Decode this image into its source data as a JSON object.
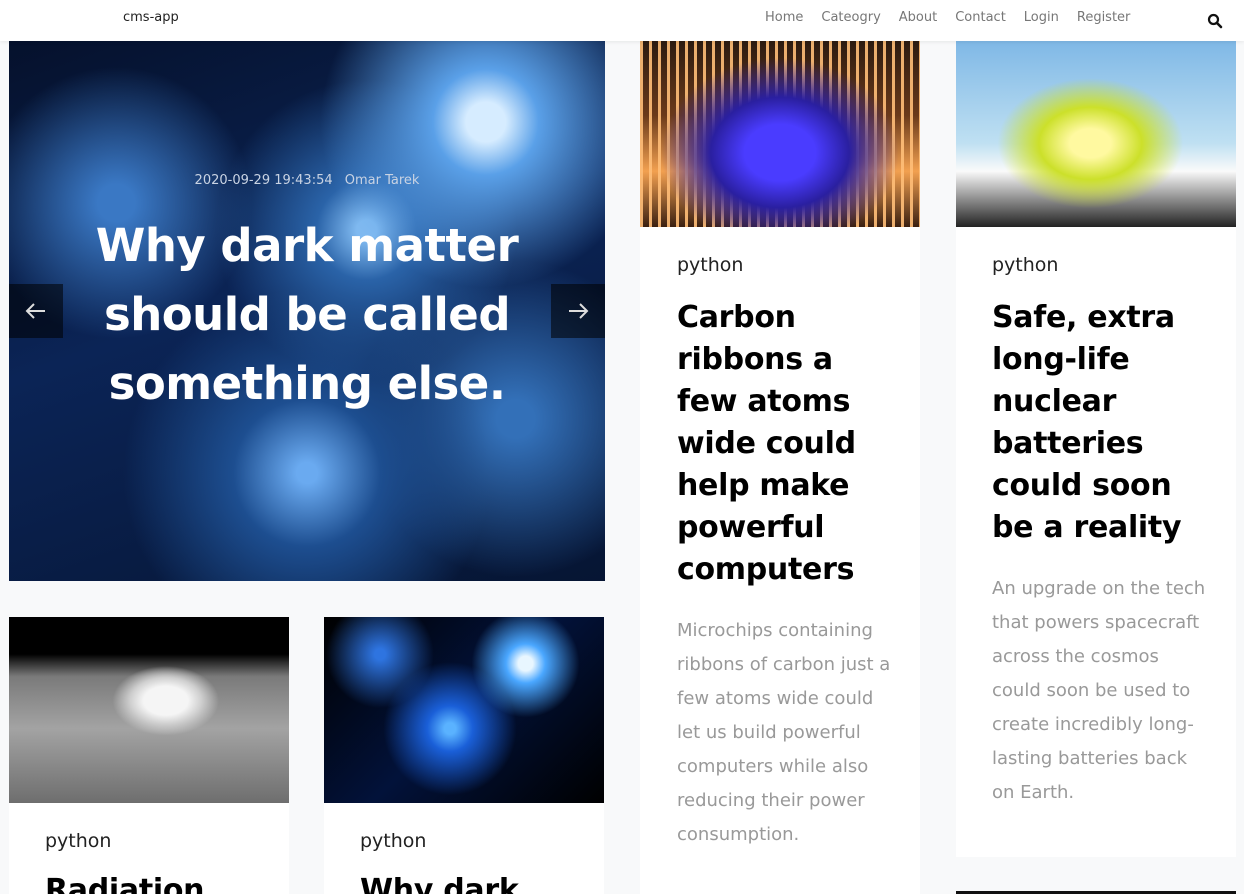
{
  "navbar": {
    "brand": "cms-app",
    "links": [
      "Home",
      "Cateogry",
      "About",
      "Contact",
      "Login",
      "Register"
    ],
    "search_icon": "search-icon"
  },
  "hero": {
    "date": "2020-09-29 19:43:54",
    "author": "Omar Tarek",
    "title": "Why dark matter should be called something else.",
    "prev_icon": "arrow-left-icon",
    "next_icon": "arrow-right-icon"
  },
  "cards": [
    {
      "category": "python",
      "title": "Carbon ribbons a few atoms wide could help make powerful computers",
      "excerpt": "Microchips containing ribbons of carbon just a few atoms wide could let us build powerful computers while also reducing their power consumption."
    },
    {
      "category": "python",
      "title": "Safe, extra long-life nuclear batteries could soon be a reality",
      "excerpt": "An upgrade on the tech that powers spacecraft across the cosmos could soon be used to create incredibly long-lasting batteries back on Earth."
    },
    {
      "category": "python",
      "title": "Radiation"
    },
    {
      "category": "python",
      "title": "Why dark"
    }
  ]
}
